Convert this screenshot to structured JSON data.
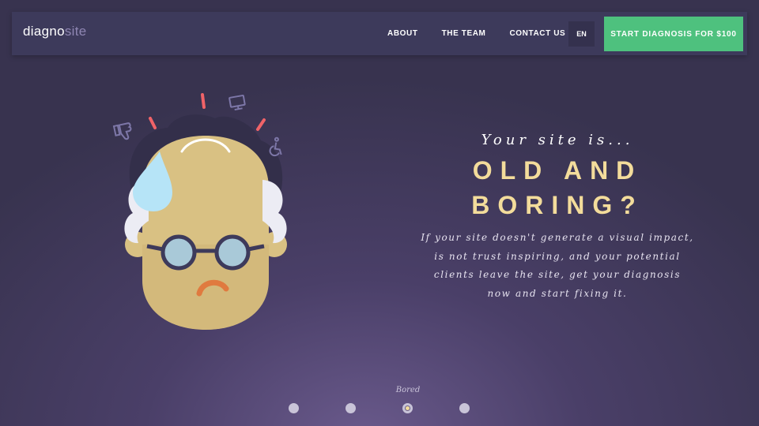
{
  "header": {
    "logo": {
      "part1": "diagno",
      "part2": "site"
    },
    "nav": [
      {
        "label": "ABOUT"
      },
      {
        "label": "THE TEAM"
      },
      {
        "label": "CONTACT US"
      }
    ],
    "language": "EN",
    "cta_label": "START DIAGNOSIS FOR $100"
  },
  "hero": {
    "kicker": "Your site is...",
    "title_line1": "OLD AND",
    "title_line2": "BORING?",
    "body": "If your site doesn't generate a visual impact, is not trust inspiring, and your potential clients leave the site, get your diagnosis now and start fixing it."
  },
  "slider": {
    "caption": "Bored",
    "active_index": 2,
    "count": 4
  },
  "colors": {
    "background": "#38334f",
    "navbar": "#3d3a5b",
    "cta": "#4ec17e",
    "headline": "#f3dc9b"
  },
  "icons": [
    "thumbs-down-icon",
    "monitor-icon",
    "wheelchair-icon",
    "sweat-drop-icon"
  ]
}
